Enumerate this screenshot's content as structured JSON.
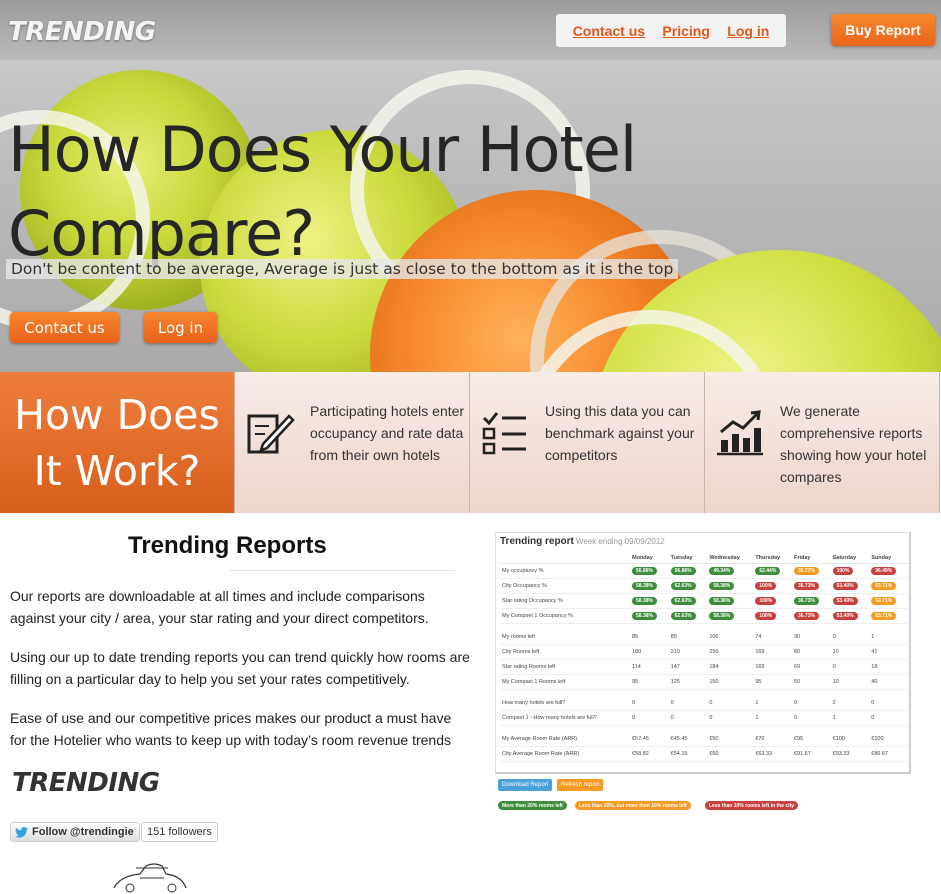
{
  "brand": "TRENDING",
  "nav": {
    "contact": "Contact us",
    "pricing": "Pricing",
    "login": "Log in"
  },
  "buy_button": "Buy Report",
  "hero": {
    "title": " How Does Your Hotel Compare?",
    "subtitle": "Don't be content to be average, Average is just as close to the bottom as it is the top",
    "contact_button": "Contact us",
    "login_button": "Log in"
  },
  "how": {
    "title": "How Does It Work?",
    "steps": [
      {
        "icon": "edit-icon",
        "text": "Participating hotels enter occupancy and rate data from their own hotels"
      },
      {
        "icon": "checklist-icon",
        "text": "Using this data you can benchmark against your competitors"
      },
      {
        "icon": "bar-chart-icon",
        "text": "We generate comprehensive reports showing how your hotel compares"
      }
    ]
  },
  "reports": {
    "title": "Trending Reports",
    "paragraphs": [
      "Our reports are downloadable at all times and include comparisons against your city / area, your star rating and your direct competitors.",
      "Using our up to date trending reports you can trend quickly how rooms are filling on a particular day to help you set your rates competitively.",
      "Ease of use and our competitive prices makes our product a must have for the Hotelier who wants to keep up with today’s room revenue trends"
    ]
  },
  "twitter": {
    "follow": "Follow @trendingie",
    "followers": "151 followers"
  },
  "report_image": {
    "title": "Trending report",
    "week": "Week ending 09/09/2012",
    "days": [
      "Monday",
      "Tuesday",
      "Wednesday",
      "Thursday",
      "Friday",
      "Saturday",
      "Sunday"
    ],
    "pill_rows": [
      {
        "label": "My occupancy %",
        "cells": [
          [
            "56.86%",
            "g"
          ],
          [
            "56.86%",
            "g"
          ],
          [
            "49.34%",
            "g"
          ],
          [
            "62.44%",
            "g"
          ],
          [
            "30.77%",
            "o"
          ],
          [
            "100%",
            "r"
          ],
          [
            "96.49%",
            "r"
          ]
        ]
      },
      {
        "label": "City Occupancy %",
        "cells": [
          [
            "58.38%",
            "g"
          ],
          [
            "62.63%",
            "g"
          ],
          [
            "58.38%",
            "g"
          ],
          [
            "100%",
            "r"
          ],
          [
            "36.73%",
            "r"
          ],
          [
            "53.40%",
            "r"
          ],
          [
            "63.71%",
            "o"
          ]
        ]
      },
      {
        "label": "Star rating Occupancy %",
        "cells": [
          [
            "58.38%",
            "g"
          ],
          [
            "62.63%",
            "g"
          ],
          [
            "58.38%",
            "g"
          ],
          [
            "100%",
            "r"
          ],
          [
            "36.73%",
            "g"
          ],
          [
            "53.40%",
            "r"
          ],
          [
            "63.71%",
            "o"
          ]
        ]
      },
      {
        "label": "My Compset 1 Occupancy %",
        "cells": [
          [
            "58.38%",
            "g"
          ],
          [
            "62.63%",
            "g"
          ],
          [
            "58.38%",
            "g"
          ],
          [
            "100%",
            "r"
          ],
          [
            "36.73%",
            "r"
          ],
          [
            "53.40%",
            "r"
          ],
          [
            "63.71%",
            "o"
          ]
        ]
      }
    ],
    "rooms_rows": [
      {
        "label": "My rooms left",
        "cells": [
          "85",
          "85",
          "100",
          "74",
          "30",
          "0",
          "1"
        ]
      },
      {
        "label": "City Rooms left",
        "cells": [
          "180",
          "210",
          "250",
          "169",
          "80",
          "10",
          "41"
        ]
      },
      {
        "label": "Star rating Rooms left",
        "cells": [
          "114",
          "147",
          "184",
          "169",
          "69",
          "0",
          "18"
        ]
      },
      {
        "label": "My Compset 1 Rooms left",
        "cells": [
          "95",
          "125",
          "150",
          "95",
          "50",
          "10",
          "40"
        ]
      }
    ],
    "full_rows": [
      {
        "label": "How many hotels are full?",
        "cells": [
          "0",
          "0",
          "0",
          "1",
          "0",
          "2",
          "0"
        ]
      },
      {
        "label": "Compset 1 - How many hotels are full?",
        "cells": [
          "0",
          "0",
          "0",
          "1",
          "0",
          "1",
          "0"
        ]
      }
    ],
    "rate_rows": [
      {
        "label": "My Average Room Rate (ARR)",
        "cells": [
          "€57.45",
          "€45.45",
          "€50",
          "€70",
          "€95",
          "€100",
          "€100"
        ]
      },
      {
        "label": "City Average Room Rate (ARR)",
        "cells": [
          "€58.82",
          "€54.15",
          "€60",
          "€63.33",
          "€91.67",
          "€93.33",
          "€86.67"
        ]
      }
    ],
    "download_button": "Download Report",
    "refresh_button": "Refresh report",
    "legend": [
      "More than 20% rooms left",
      "Less than 20%, but more than 10% rooms left",
      "Less than 10% rooms left in the city"
    ]
  }
}
